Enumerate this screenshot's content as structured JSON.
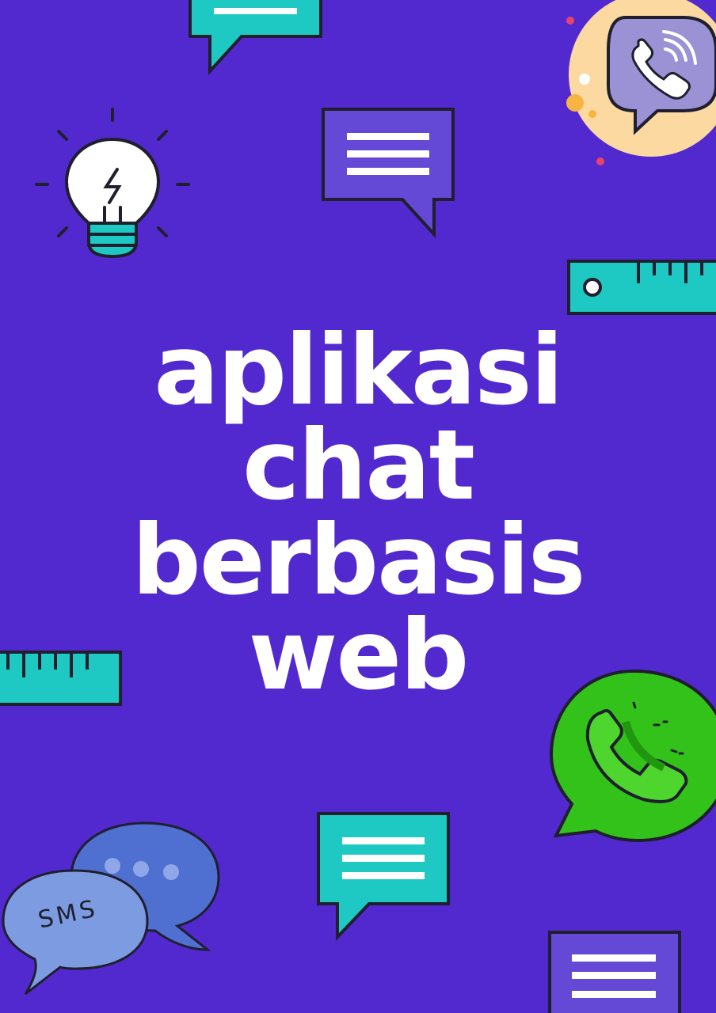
{
  "poster": {
    "title_lines": [
      "aplikasi",
      "chat",
      "berbasis",
      "web"
    ],
    "sms_label": "SMS"
  },
  "colors": {
    "background": "#5229cf",
    "teal": "#1ec9c3",
    "purple_box": "#6448d6",
    "outline": "#1f1f2e",
    "whatsapp_green": "#33c21a",
    "viber_circle": "#fbd9a0",
    "viber_bubble": "#9b92d6",
    "sms_bubble_back": "#4f6fd1",
    "sms_bubble_front": "#7d9be0"
  },
  "icons": [
    "chat-bubble-icon",
    "lightbulb-icon",
    "viber-icon",
    "ruler-icon",
    "whatsapp-icon",
    "sms-bubbles-icon"
  ]
}
